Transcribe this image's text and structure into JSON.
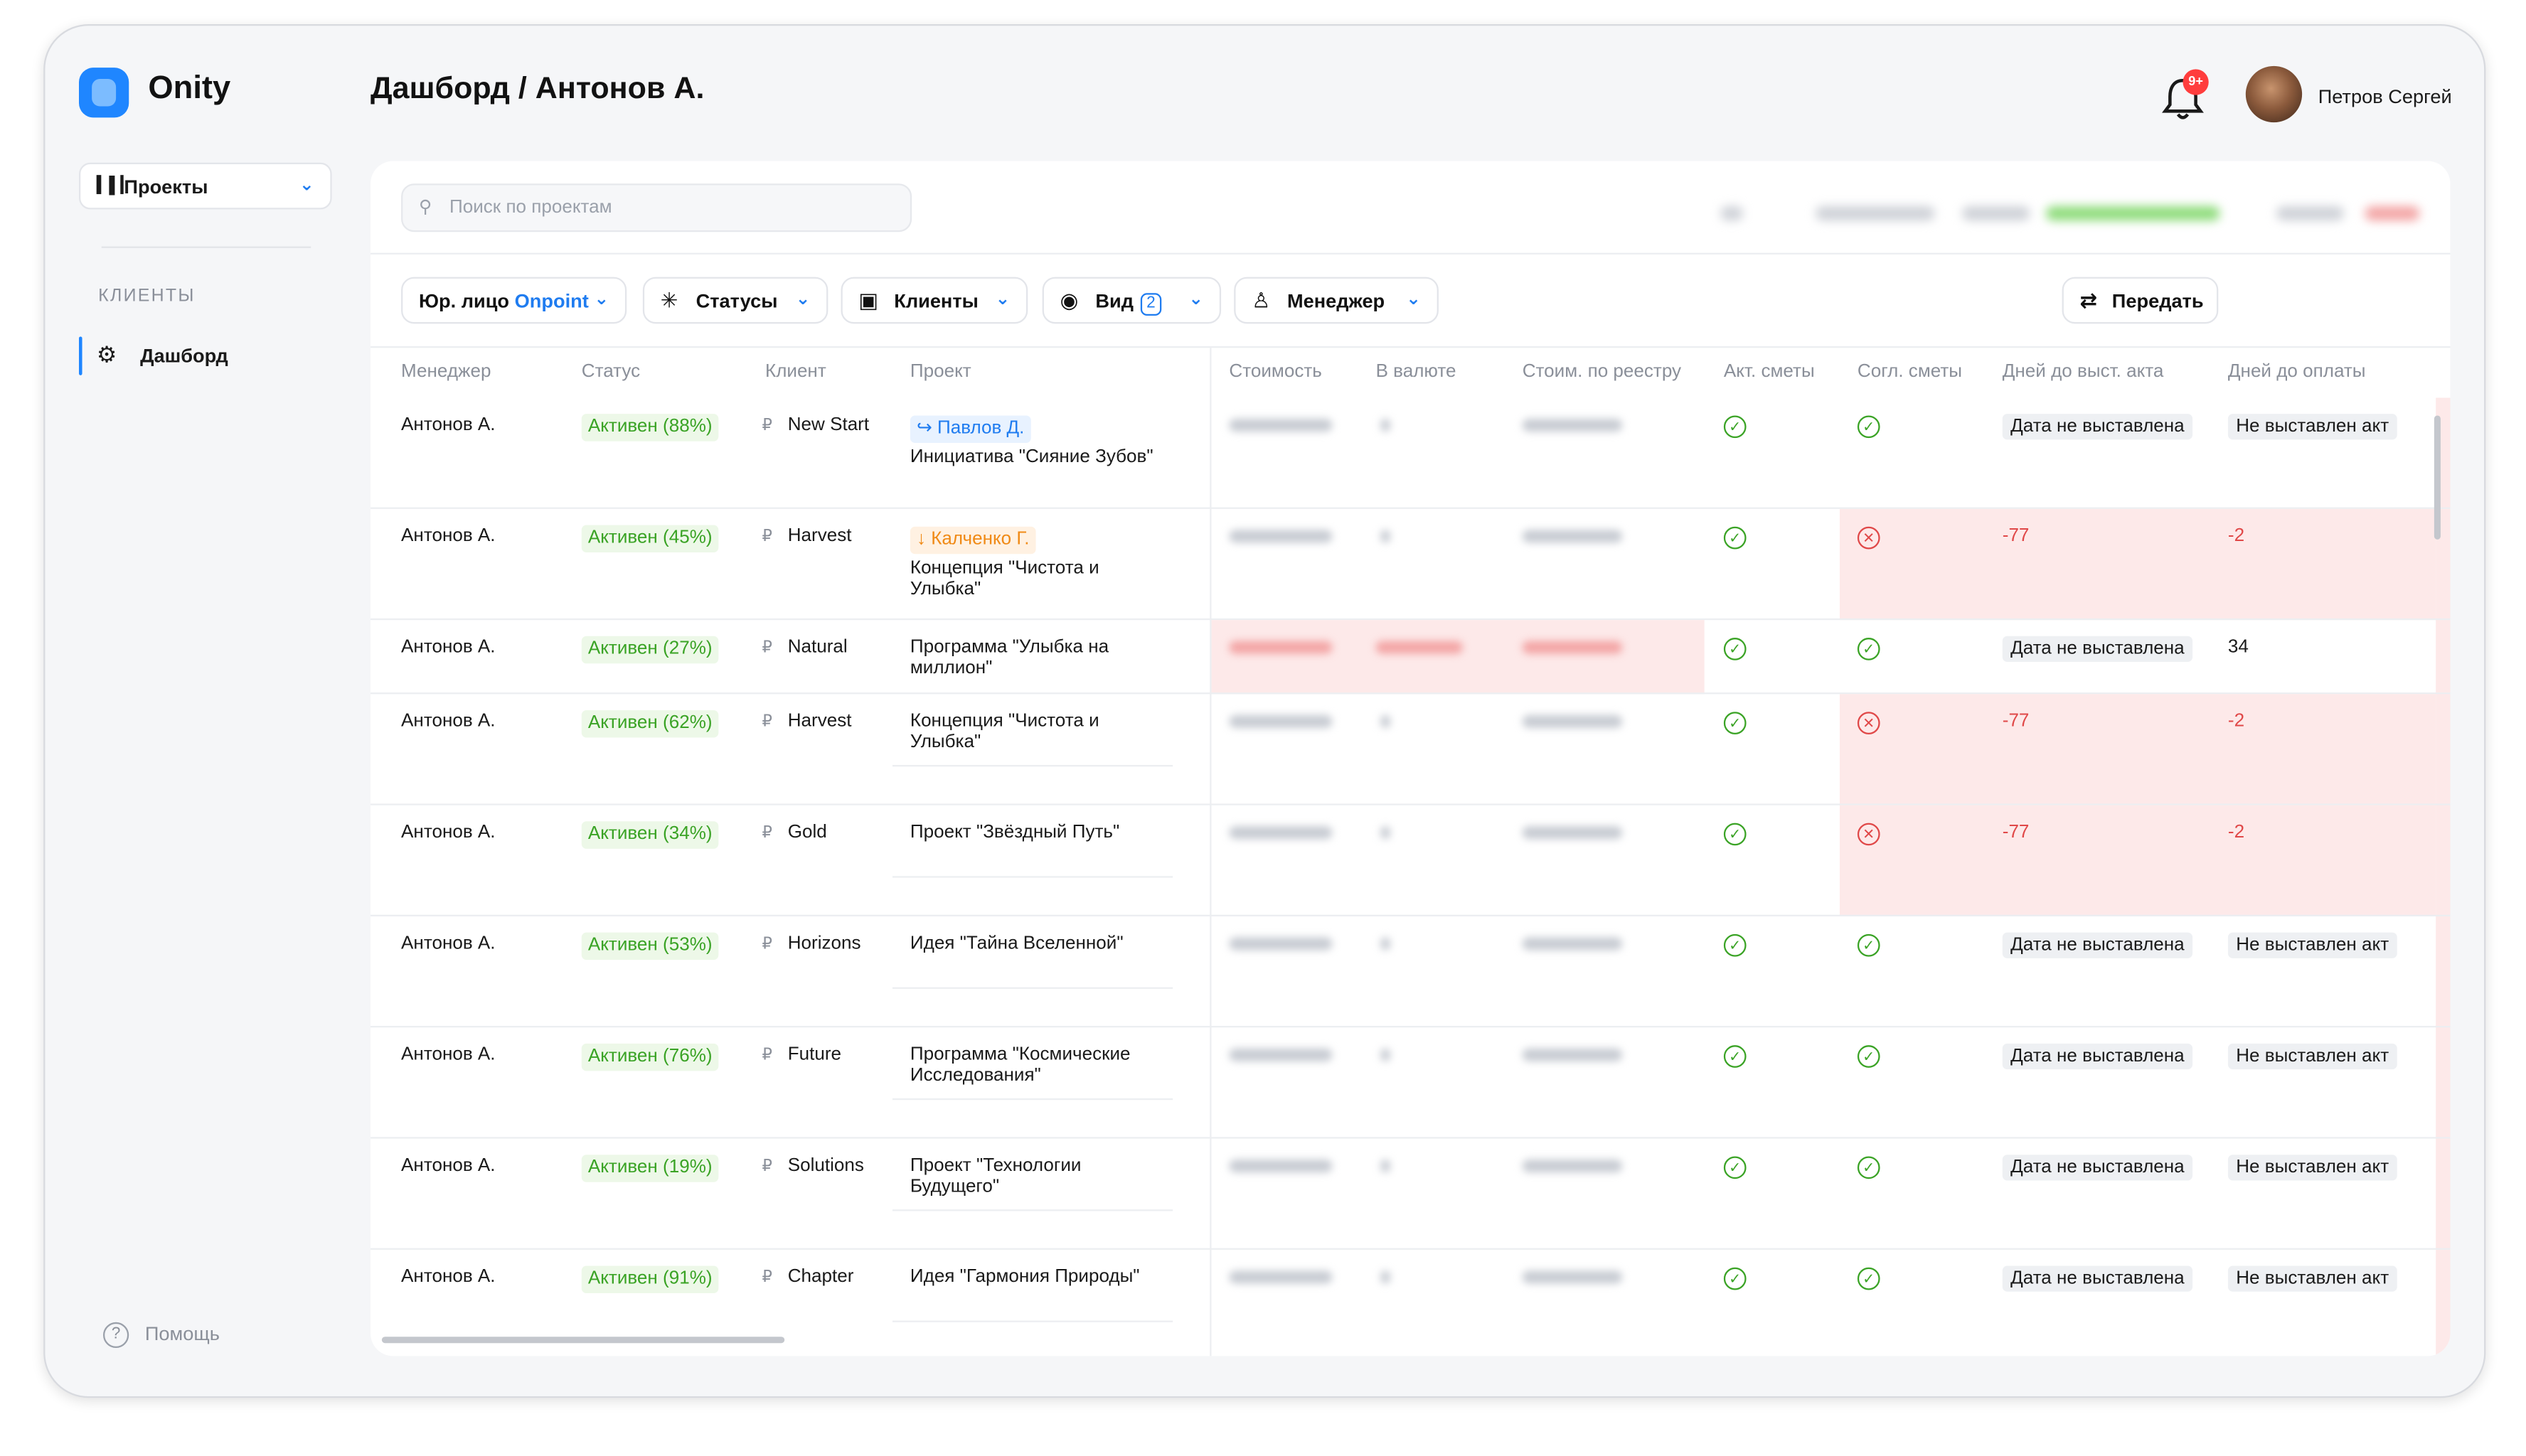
{
  "app": {
    "name": "Onity"
  },
  "sidebar": {
    "project_select": "Проекты",
    "section": "КЛИЕНТЫ",
    "items": [
      {
        "label": "Дашборд"
      }
    ],
    "help": "Помощь"
  },
  "header": {
    "title": "Дашборд / Антонов А.",
    "notifications_badge": "9+",
    "user_name": "Петров Сергей"
  },
  "search": {
    "placeholder": "Поиск по проектам"
  },
  "filters": {
    "legal": {
      "label": "Юр. лицо",
      "value": "Onpoint"
    },
    "statuses": "Статусы",
    "clients": "Клиенты",
    "view": {
      "label": "Вид",
      "count": "2"
    },
    "manager": "Менеджер",
    "transfer": "Передать"
  },
  "table": {
    "columns": [
      "Менеджер",
      "Статус",
      "Клиент",
      "Проект",
      "Стоимость",
      "В валюте",
      "Стоим. по реестру",
      "Акт. сметы",
      "Согл. сметы",
      "Дней до выст. акта",
      "Дней до оплаты"
    ],
    "rows": [
      {
        "manager": "Антонов А.",
        "status": "Активен (88%)",
        "client": "New Start",
        "tag": "↪ Павлов Д.",
        "tag_color": "blue",
        "project": "Инициатива \"Сияние Зубов\"",
        "act": "ok",
        "agreed": "ok",
        "days_act": "Дата не выставлена",
        "days_pay": "Не выставлен акт"
      },
      {
        "manager": "Антонов А.",
        "status": "Активен (45%)",
        "client": "Harvest",
        "tag": "↓ Калченко Г.",
        "tag_color": "orange",
        "project": "Концепция \"Чистота и Улыбка\"",
        "act": "ok",
        "agreed": "err",
        "days_act": "-77",
        "days_pay": "-2"
      },
      {
        "manager": "Антонов А.",
        "status": "Активен (27%)",
        "client": "Natural",
        "tag": "",
        "tag_color": "",
        "project": "Программа \"Улыбка на миллион\"",
        "act": "ok",
        "agreed": "ok",
        "days_act": "Дата не выставлена",
        "days_pay": "34"
      },
      {
        "manager": "Антонов А.",
        "status": "Активен (62%)",
        "client": "Harvest",
        "tag": "",
        "tag_color": "",
        "project": "Концепция \"Чистота и Улыбка\"",
        "act": "ok",
        "agreed": "err",
        "days_act": "-77",
        "days_pay": "-2"
      },
      {
        "manager": "Антонов А.",
        "status": "Активен (34%)",
        "client": "Gold",
        "tag": "",
        "tag_color": "",
        "project": "Проект \"Звёздный Путь\"",
        "act": "ok",
        "agreed": "err",
        "days_act": "-77",
        "days_pay": "-2"
      },
      {
        "manager": "Антонов А.",
        "status": "Активен (53%)",
        "client": "Horizons",
        "tag": "",
        "tag_color": "",
        "project": "Идея \"Тайна Вселенной\"",
        "act": "ok",
        "agreed": "ok",
        "days_act": "Дата не выставлена",
        "days_pay": "Не выставлен акт"
      },
      {
        "manager": "Антонов А.",
        "status": "Активен (76%)",
        "client": "Future",
        "tag": "",
        "tag_color": "",
        "project": "Программа \"Космические Исследования\"",
        "act": "ok",
        "agreed": "ok",
        "days_act": "Дата не выставлена",
        "days_pay": "Не выставлен акт"
      },
      {
        "manager": "Антонов А.",
        "status": "Активен (19%)",
        "client": "Solutions",
        "tag": "",
        "tag_color": "",
        "project": "Проект \"Технологии Будущего\"",
        "act": "ok",
        "agreed": "ok",
        "days_act": "Дата не выставлена",
        "days_pay": "Не выставлен акт"
      },
      {
        "manager": "Антонов А.",
        "status": "Активен (91%)",
        "client": "Chapter",
        "tag": "",
        "tag_color": "",
        "project": "Идея \"Гармония Природы\"",
        "act": "ok",
        "agreed": "ok",
        "days_act": "Дата не выставлена",
        "days_pay": "Не выставлен акт"
      }
    ]
  },
  "colors": {
    "accent": "#1f86ff",
    "success": "#3aa325",
    "danger": "#e04848",
    "danger_bg": "#fde9e9",
    "warning": "#f08a16"
  }
}
